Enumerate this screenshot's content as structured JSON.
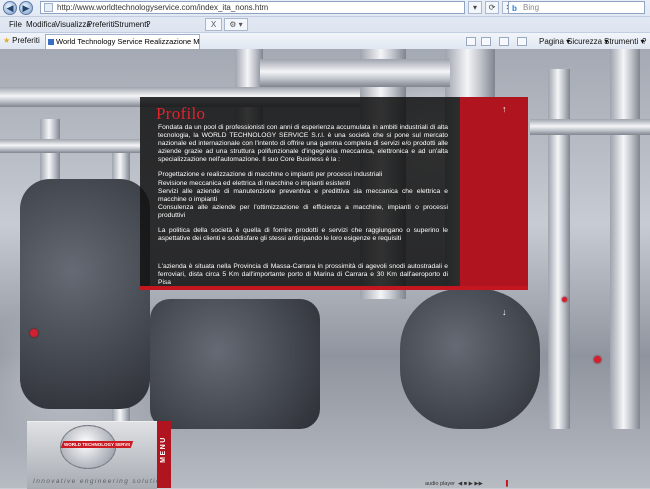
{
  "browser": {
    "address": "http://www.worldtechnologyservice.com/index_ita_nons.htm",
    "search_placeholder": "Bing",
    "search_brand": "b",
    "back_glyph": "◀",
    "forward_glyph": "▶",
    "menu": [
      "File",
      "Modifica",
      "Visualizza",
      "Preferiti",
      "Strumenti",
      "?"
    ],
    "tab_close_glyph": "X",
    "tab_extra_glyph": "⚙ ▾",
    "favorites_label": "Preferiti",
    "tab_title": "World Technology Service Realizzazione Machine, Im...",
    "commands": {
      "page": "Pagina ▾",
      "security": "Sicurezza ▾",
      "tools": "Strumenti ▾",
      "help": "?"
    },
    "addr_tool_glyphs": [
      "▾",
      "⟳",
      "✕"
    ],
    "brand_colors": {
      "accent_red": "#c4161f",
      "panel_dark": "#121212"
    }
  },
  "profile": {
    "title": "Profilo",
    "intro": "Fondata da un pool di professionisti con anni di esperienza accumulata in ambiti industriali di alta tecnologia, la WORLD TECHNOLOGY SERVICE S.r.l. è una società che si pone sul mercato nazionale ed internazionale con l'intento di offrire una gamma completa di servizi e/o prodotti alle aziende grazie ad una struttura polifunzionale d'ingegneria meccanica, elettronica e ad un'alta specializzazione nell'automazione. Il suo Core Business è la :",
    "business_1": "Progettazione e realizzazione di macchine o impianti per processi industriali",
    "business_2": "Revisione meccanica ed elettrica di macchine o impianti esistenti",
    "business_3": "Servizi alle aziende di manutenzione preventiva e predittiva sia meccanica che elettrica e macchine o impianti",
    "business_4": "Consulenza alle aziende per l'ottimizzazione di efficienza a macchine, impianti o processi produttivi",
    "policy": "La politica della società è quella di fornire prodotti e servizi che raggiungano o superino le aspettative dei clienti e soddisfare gli stessi anticipando le loro esigenze e requisiti",
    "location": "L'azienda è situata nella Provincia di Massa-Carrara in prossimità di agevoli snodi autostradali e ferroviari, dista circa 5 Km dall'importante porto di Marina di Carrara e 30 Km dall'aeroporto di Pisa",
    "arrow_up": "↑",
    "arrow_down": "↓"
  },
  "footer": {
    "logo_text": "WORLD TECHNOLOGY SERVICE",
    "tagline": "Innovative engineering solutions",
    "menu_label": "MENU",
    "audio_label": "audio player",
    "audio_controls": "◀ ■ ▶ ▶▶",
    "audio_stop": "▐"
  }
}
